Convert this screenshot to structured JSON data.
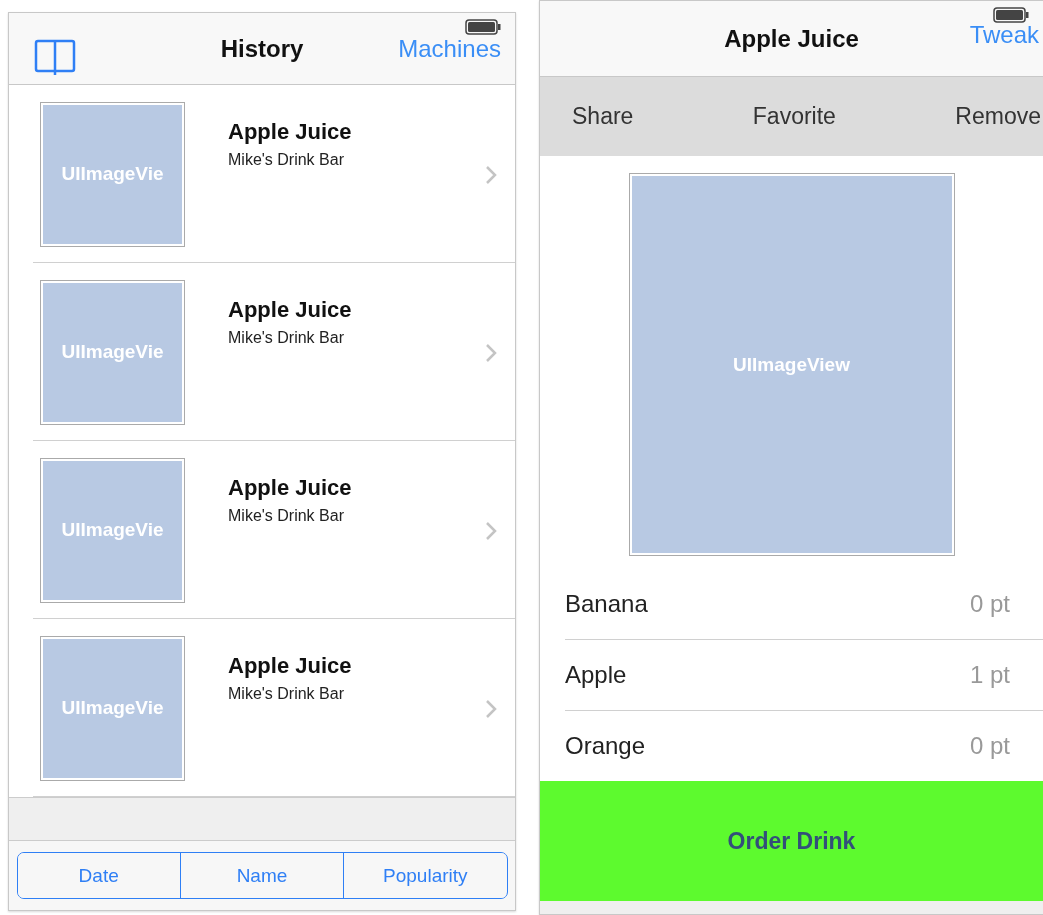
{
  "history_screen": {
    "nav_bar": {
      "title": "History",
      "right_button": "Machines"
    },
    "rows": [
      {
        "image_label": "UIImageVie",
        "title": "Apple Juice",
        "subtitle": "Mike's Drink Bar"
      },
      {
        "image_label": "UIImageVie",
        "title": "Apple Juice",
        "subtitle": "Mike's Drink Bar"
      },
      {
        "image_label": "UIImageVie",
        "title": "Apple Juice",
        "subtitle": "Mike's Drink Bar"
      },
      {
        "image_label": "UIImageVie",
        "title": "Apple Juice",
        "subtitle": "Mike's Drink Bar"
      }
    ],
    "sort_segments": [
      {
        "label": "Date",
        "selected": false
      },
      {
        "label": "Name",
        "selected": false
      },
      {
        "label": "Popularity",
        "selected": false
      }
    ]
  },
  "detail_screen": {
    "nav_bar": {
      "title": "Apple Juice",
      "right_button": "Tweak"
    },
    "actions": [
      "Share",
      "Favorite",
      "Remove"
    ],
    "image_label": "UIImageView",
    "ingredients": [
      {
        "name": "Banana",
        "amount": "0 pt"
      },
      {
        "name": "Apple",
        "amount": "1 pt"
      },
      {
        "name": "Orange",
        "amount": "0 pt"
      }
    ],
    "order_button": "Order Drink"
  }
}
